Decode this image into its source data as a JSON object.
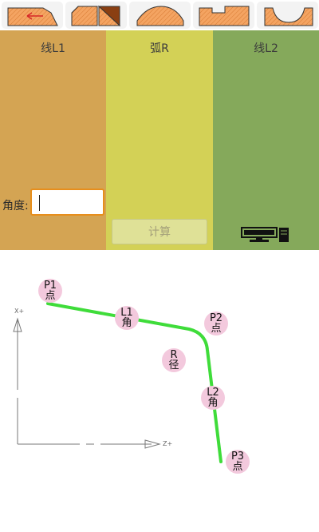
{
  "toolbar": {
    "tools": [
      {
        "icon": "chamfer-back-arrow-icon"
      },
      {
        "icon": "chamfer-double-icon"
      },
      {
        "icon": "arc-convex-icon"
      },
      {
        "icon": "step-notch-icon"
      },
      {
        "icon": "arc-concave-icon"
      }
    ]
  },
  "panels": {
    "line_l1": {
      "title": "线L1",
      "angle_label": "角度:",
      "angle_value": ""
    },
    "arc_r": {
      "title": "弧R",
      "calc_label": "计算"
    },
    "line_l2": {
      "title": "线L2",
      "icon": "computer-monitor-icon"
    }
  },
  "diagram": {
    "points": {
      "p1": {
        "top": "P1",
        "bottom": "点"
      },
      "p2": {
        "top": "P2",
        "bottom": "点"
      },
      "p3": {
        "top": "P3",
        "bottom": "点"
      },
      "l1": {
        "top": "L1",
        "bottom": "角"
      },
      "l2": {
        "top": "L2",
        "bottom": "角"
      },
      "r": {
        "top": "R",
        "bottom": "径"
      }
    },
    "axes": {
      "x_label": "X+",
      "z_label": "Z+"
    }
  },
  "colors": {
    "panel_l1": "#d4a453",
    "panel_r": "#d3d156",
    "panel_l2": "#85a95b",
    "input_border": "#e78e1c",
    "path": "#3fdc3a",
    "marker": "#f3c9dd"
  }
}
